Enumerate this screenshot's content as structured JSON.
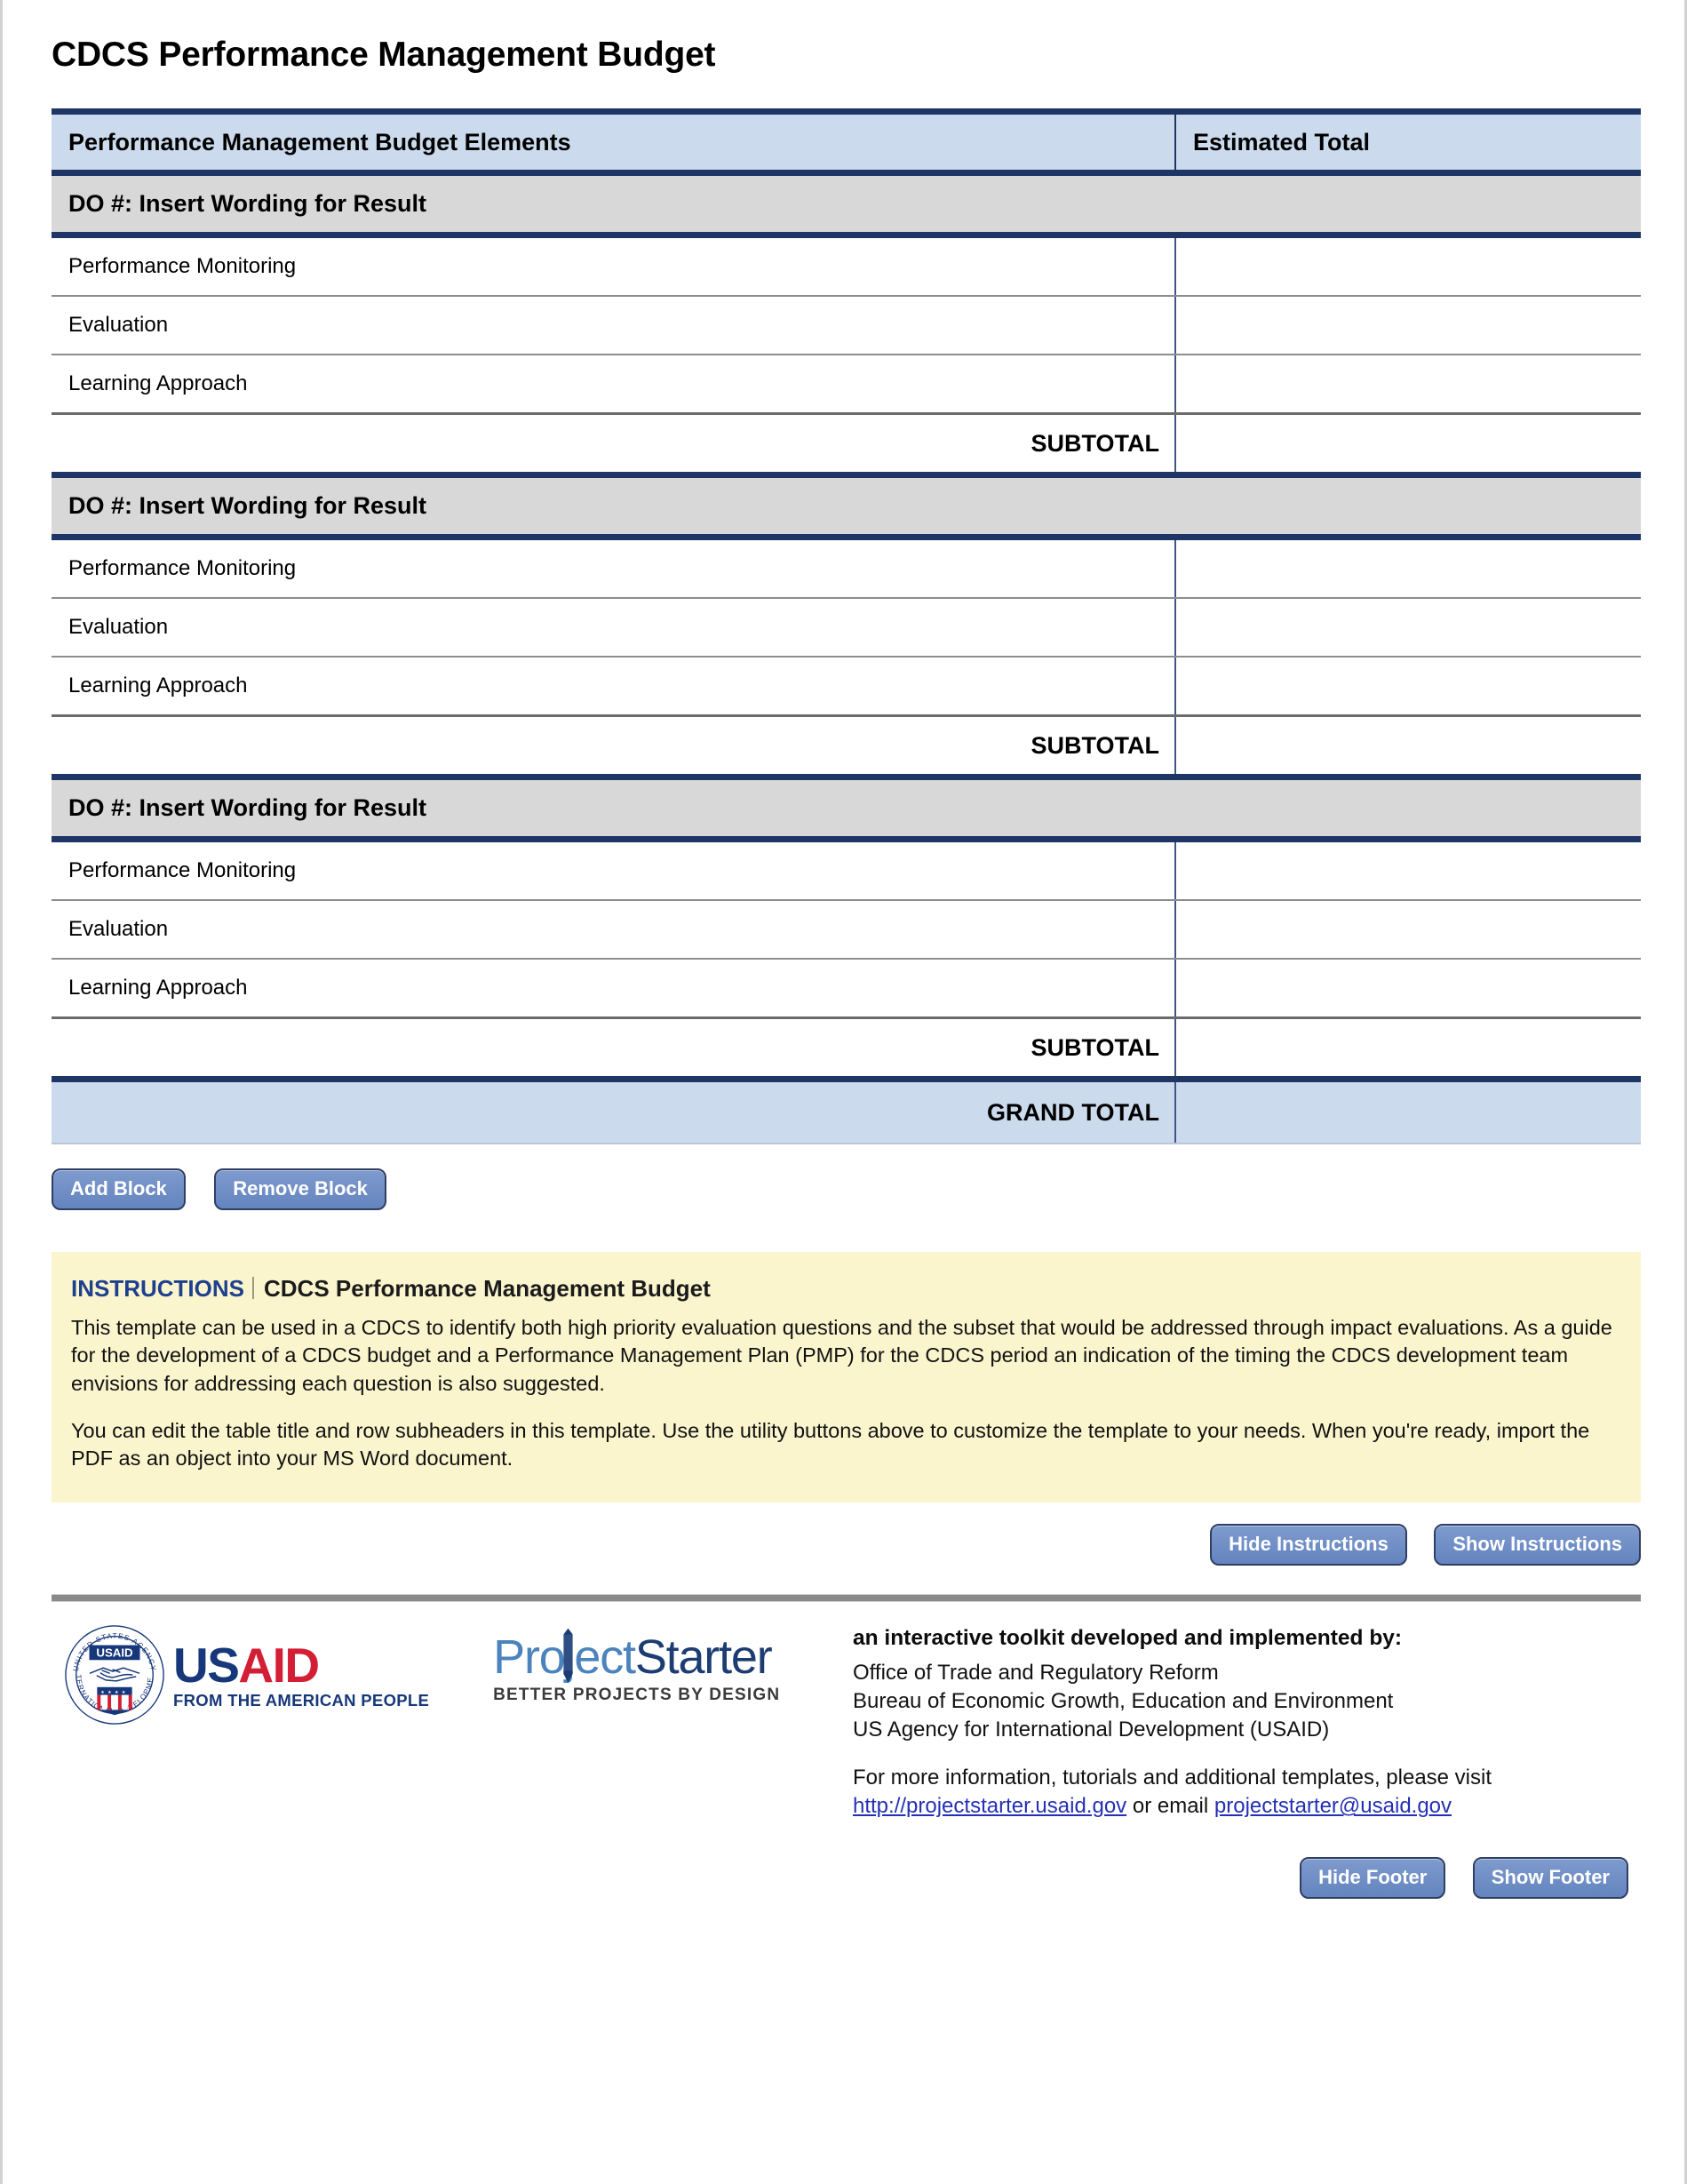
{
  "document": {
    "title": "CDCS Performance Management Budget"
  },
  "table": {
    "columns": [
      "Performance Management Budget Elements",
      "Estimated Total"
    ],
    "blocks": [
      {
        "heading": "DO #: Insert Wording for Result",
        "rows": [
          "Performance Monitoring",
          "Evaluation",
          "Learning Approach"
        ],
        "subtotal_label": "SUBTOTAL",
        "subtotal_value": ""
      },
      {
        "heading": "DO #: Insert Wording for Result",
        "rows": [
          "Performance Monitoring",
          "Evaluation",
          "Learning Approach"
        ],
        "subtotal_label": "SUBTOTAL",
        "subtotal_value": ""
      },
      {
        "heading": "DO #: Insert Wording for Result",
        "rows": [
          "Performance Monitoring",
          "Evaluation",
          "Learning Approach"
        ],
        "subtotal_label": "SUBTOTAL",
        "subtotal_value": ""
      }
    ],
    "grand_total_label": "GRAND TOTAL",
    "grand_total_value": ""
  },
  "table_buttons": {
    "add_block": "Add Block",
    "remove_block": "Remove Block"
  },
  "instructions": {
    "label": "INSTRUCTIONS",
    "title": "CDCS Performance Management Budget",
    "paragraph1": "This template can be used in a CDCS to identify both high priority evaluation questions and the subset that would be addressed through impact evaluations. As a guide for the development of a CDCS budget and a Performance Management Plan (PMP) for the CDCS period an indication of the timing the CDCS development team envisions for addressing each question is also suggested.",
    "paragraph2": "You can edit the table title and row subheaders in this template. Use the utility buttons above to customize the template to your needs. When you're ready, import the PDF as an object into your MS Word document.",
    "hide_button": "Hide Instructions",
    "show_button": "Show Instructions"
  },
  "footer": {
    "usaid_logo": {
      "word_us": "US",
      "word_aid": "AID",
      "tagline": "FROM THE AMERICAN PEOPLE",
      "seal_top_text": "UNITED STATES AGENCY",
      "seal_bottom_text": "INTERNATIONAL DEVELOPMENT",
      "seal_box_text": "USAID"
    },
    "projectstarter_logo": {
      "part1": "Pr",
      "part2": "oj",
      "part3": "ect",
      "part4": "Starter",
      "tagline": "BETTER PROJECTS BY DESIGN"
    },
    "lead": "an interactive toolkit developed and implemented by:",
    "org_line1": "Office of Trade and Regulatory Reform",
    "org_line2": "Bureau of Economic Growth, Education and Environment",
    "org_line3": "US Agency for International Development (USAID)",
    "more_prefix": "For more information, tutorials and additional templates, please visit ",
    "website": "http://projectstarter.usaid.gov",
    "more_middle": " or email ",
    "email": "projectstarter@usaid.gov",
    "hide_button": "Hide Footer",
    "show_button": "Show Footer"
  },
  "colors": {
    "accent_navy": "#1f3566",
    "header_blue": "#ccdaed",
    "block_gray": "#d8d8d8",
    "button_blue": "#6b8cc4",
    "instructions_yellow": "#faf5cd",
    "link_blue": "#2430b5",
    "usaid_red": "#d31f36",
    "usaid_blue": "#16387a"
  }
}
